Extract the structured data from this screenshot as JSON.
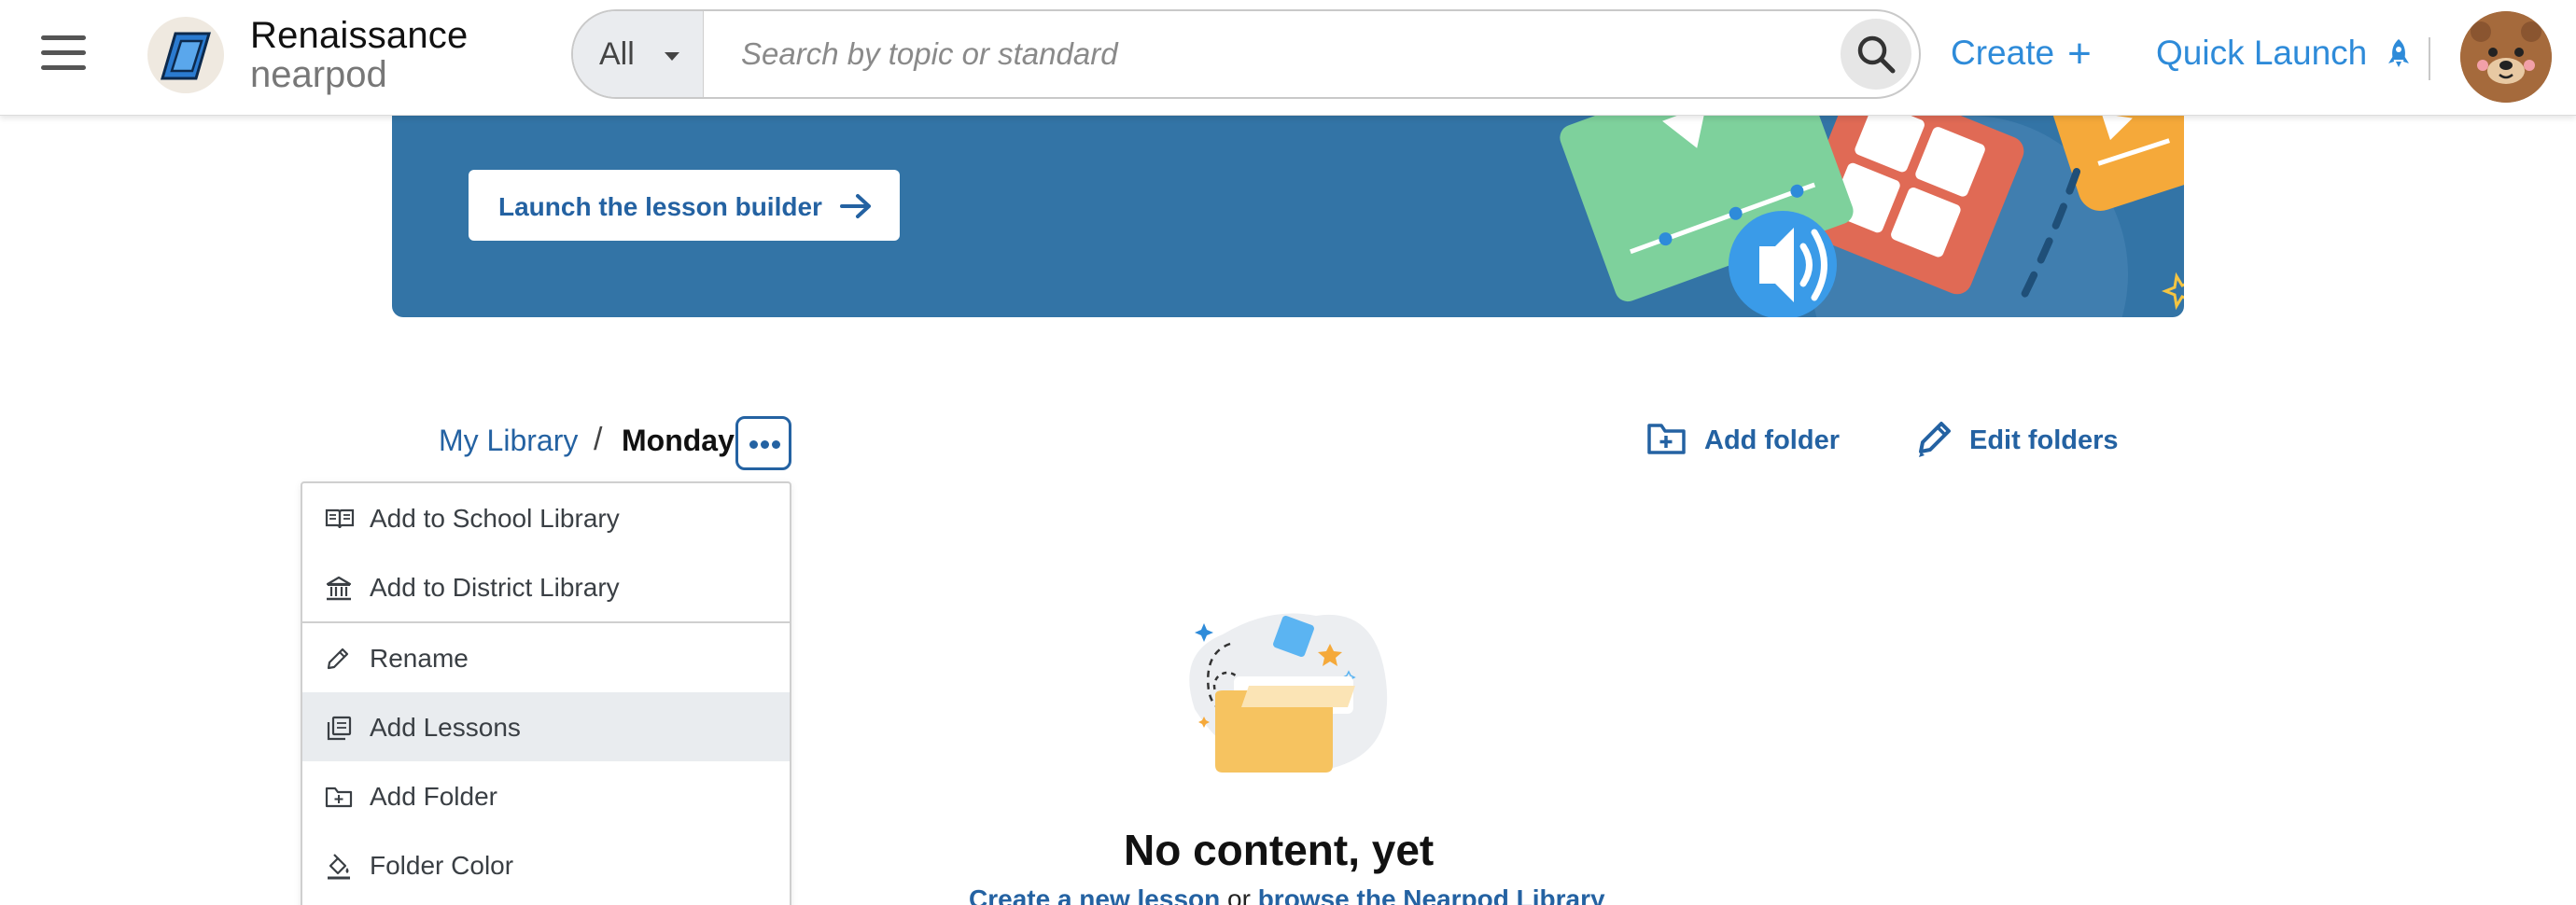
{
  "header": {
    "menu_icon": "hamburger-menu-icon",
    "brand_top": "Renaissance",
    "brand_bottom": "nearpod",
    "search": {
      "filter_value": "All",
      "placeholder": "Search by topic or standard",
      "icon": "search-icon"
    },
    "create_label": "Create",
    "create_icon": "+",
    "quick_launch_label": "Quick Launch",
    "quick_launch_icon": "rocket-icon",
    "avatar": "bear-avatar"
  },
  "banner": {
    "button_label": "Launch the lesson builder",
    "button_icon": "arrow-right-icon",
    "background_color": "#3374a6"
  },
  "breadcrumb": {
    "root": "My Library",
    "separator": "/",
    "current": "Monday"
  },
  "actions": {
    "add_folder": "Add folder",
    "edit_folders": "Edit folders"
  },
  "folder_menu": {
    "items": [
      {
        "label": "Add to School Library",
        "icon": "book-icon"
      },
      {
        "label": "Add to District Library",
        "icon": "building-icon"
      },
      {
        "label": "Rename",
        "icon": "pencil-icon"
      },
      {
        "label": "Add Lessons",
        "icon": "copy-icon",
        "highlighted": true
      },
      {
        "label": "Add Folder",
        "icon": "folder-plus-icon"
      },
      {
        "label": "Folder Color",
        "icon": "paint-bucket-icon"
      }
    ]
  },
  "empty_state": {
    "title": "No content, yet",
    "link_create": "Create a new lesson",
    "middle_text": " or ",
    "link_browse": "browse the Nearpod Library"
  },
  "colors": {
    "link_blue": "#2e8bd9",
    "dark_blue": "#2462a2",
    "menu_highlight": "#e9ecef"
  }
}
